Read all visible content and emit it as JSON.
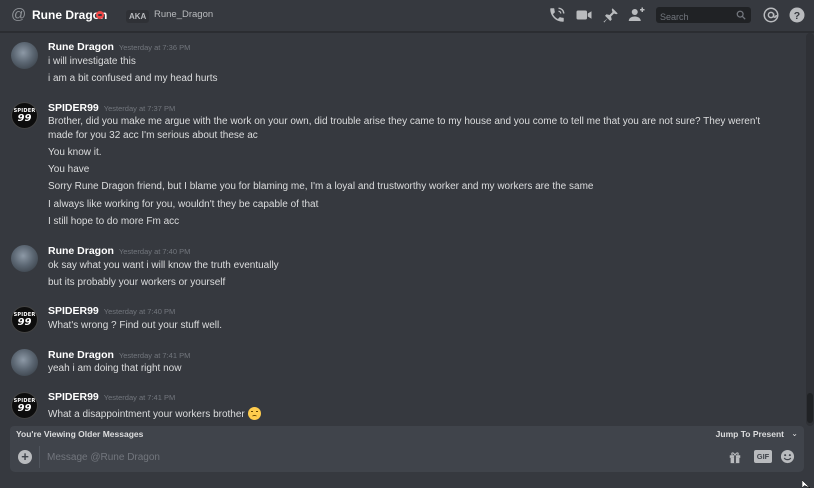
{
  "header": {
    "title": "Rune Dragon",
    "aka_badge": "AKA",
    "aka_name": "Rune_Dragon",
    "search_placeholder": "Search",
    "icons": [
      "at-icon",
      "dnd-status-icon",
      "phone-call-icon",
      "video-call-icon",
      "pin-icon",
      "add-friend-icon",
      "search-icon",
      "mention-icon",
      "help-icon"
    ]
  },
  "messages": [
    {
      "author": "Rune Dragon",
      "timestamp": "Yesterday at 7:36 PM",
      "avatar": "rune-dragon-avatar",
      "lines": [
        "i will investigate this",
        "i am a bit confused and my head hurts"
      ]
    },
    {
      "author": "SPIDER99",
      "timestamp": "Yesterday at 7:37 PM",
      "avatar": "spider99-avatar",
      "avatar_text": [
        "SPIDER",
        "99"
      ],
      "lines": [
        "Brother, did you make me argue with the work on your own, did trouble arise they came to my house and you come to tell me that you are not sure? They weren't made for you 32 acc I'm serious about these ac",
        "You know it.",
        "You have",
        "Sorry Rune Dragon friend, but I blame you for blaming me, I'm a loyal and trustworthy worker and my workers are the same",
        "I always like working for you, wouldn't they be capable of that",
        "I still hope to do more Fm acc"
      ]
    },
    {
      "author": "Rune Dragon",
      "timestamp": "Yesterday at 7:40 PM",
      "avatar": "rune-dragon-avatar",
      "lines": [
        "ok say what you want i will know the truth eventually",
        "but its probably your workers or yourself"
      ]
    },
    {
      "author": "SPIDER99",
      "timestamp": "Yesterday at 7:40 PM",
      "avatar": "spider99-avatar",
      "avatar_text": [
        "SPIDER",
        "99"
      ],
      "lines": [
        "What's wrong ? Find out your stuff well."
      ]
    },
    {
      "author": "Rune Dragon",
      "timestamp": "Yesterday at 7:41 PM",
      "avatar": "rune-dragon-avatar",
      "lines": [
        "yeah i am doing that right now"
      ]
    },
    {
      "author": "SPIDER99",
      "timestamp": "Yesterday at 7:41 PM",
      "avatar": "spider99-avatar",
      "avatar_text": [
        "SPIDER",
        "99"
      ],
      "lines": [
        "What a disappointment your workers brother"
      ],
      "emoji": "disappointed-face-emoji"
    }
  ],
  "older_bar": {
    "label": "You're Viewing Older Messages",
    "jump_label": "Jump To Present"
  },
  "composer": {
    "placeholder": "Message @Rune Dragon",
    "gif_label": "GIF"
  },
  "colors": {
    "background": "#36393f",
    "input_background": "#40444b",
    "dnd_status": "#f04747",
    "text": "#dcddde",
    "muted": "#72767d"
  }
}
